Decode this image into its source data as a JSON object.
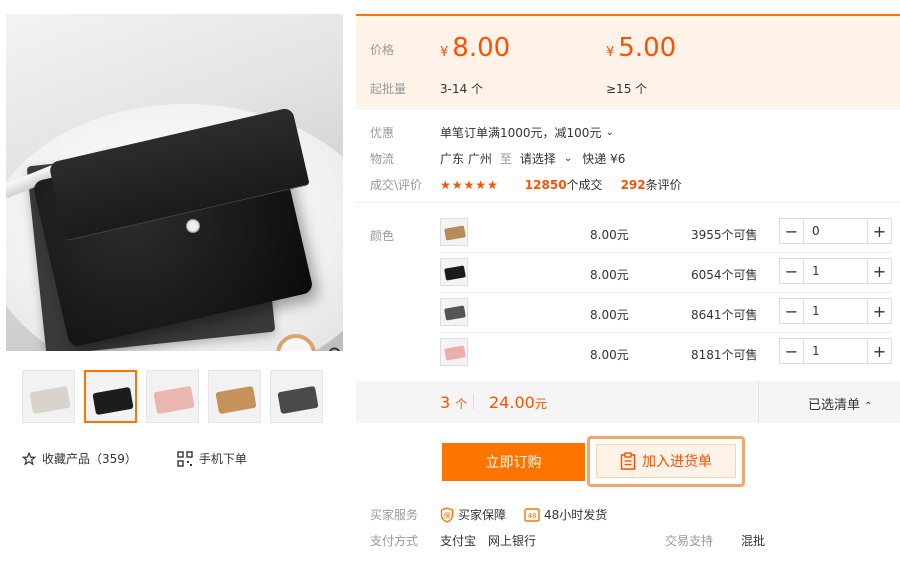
{
  "gallery": {
    "thumb_colors": [
      "#d9d3cc",
      "#1c1c1c",
      "#e9b6b0",
      "#c7925a",
      "#4a4a4a"
    ],
    "active_thumb_index": 1
  },
  "left_actions": {
    "favorite_label": "收藏产品（359）",
    "mobile_order_label": "手机下单"
  },
  "price": {
    "price_label": "价格",
    "tiers": [
      {
        "currency": "¥",
        "price": "8.00",
        "moq": "3-14 个"
      },
      {
        "currency": "¥",
        "price": "5.00",
        "moq": "≥15 个"
      }
    ],
    "moq_label": "起批量"
  },
  "info": {
    "promo_label": "优惠",
    "promo_text": "单笔订单满1000元，减100元",
    "logistics_label": "物流",
    "origin": "广东 广州",
    "to_word": "至",
    "destination": "请选择",
    "express": "快递 ¥6",
    "deals_label": "成交\\评价",
    "rating_stars": "★★★★★",
    "deals_count": "12850",
    "deals_unit": "个成交",
    "reviews_count": "292",
    "reviews_unit": "条评价"
  },
  "sku": {
    "color_label": "颜色",
    "rows": [
      {
        "swatch": "#b88a56",
        "price": "8.00元",
        "stock": "3955个可售",
        "qty": "0"
      },
      {
        "swatch": "#1b1b1b",
        "price": "8.00元",
        "stock": "6054个可售",
        "qty": "1"
      },
      {
        "swatch": "#555555",
        "price": "8.00元",
        "stock": "8641个可售",
        "qty": "1"
      },
      {
        "swatch": "#e9b0aa",
        "price": "8.00元",
        "stock": "8181个可售",
        "qty": "1"
      }
    ]
  },
  "summary": {
    "count": "3",
    "count_unit": "个",
    "total": "24.00",
    "total_unit": "元",
    "selected_label": "已选清单"
  },
  "actions": {
    "order_label": "立即订购",
    "cart_label": "加入进货单"
  },
  "footer": {
    "service_label": "买家服务",
    "service_1": "买家保障",
    "service_2": "48小时发货",
    "payment_label": "支付方式",
    "pay_1": "支付宝",
    "pay_2": "网上银行",
    "trade_label": "交易支持",
    "trade_value": "混批"
  },
  "colors": {
    "accent": "#ff7300",
    "price": "#ff5000"
  }
}
